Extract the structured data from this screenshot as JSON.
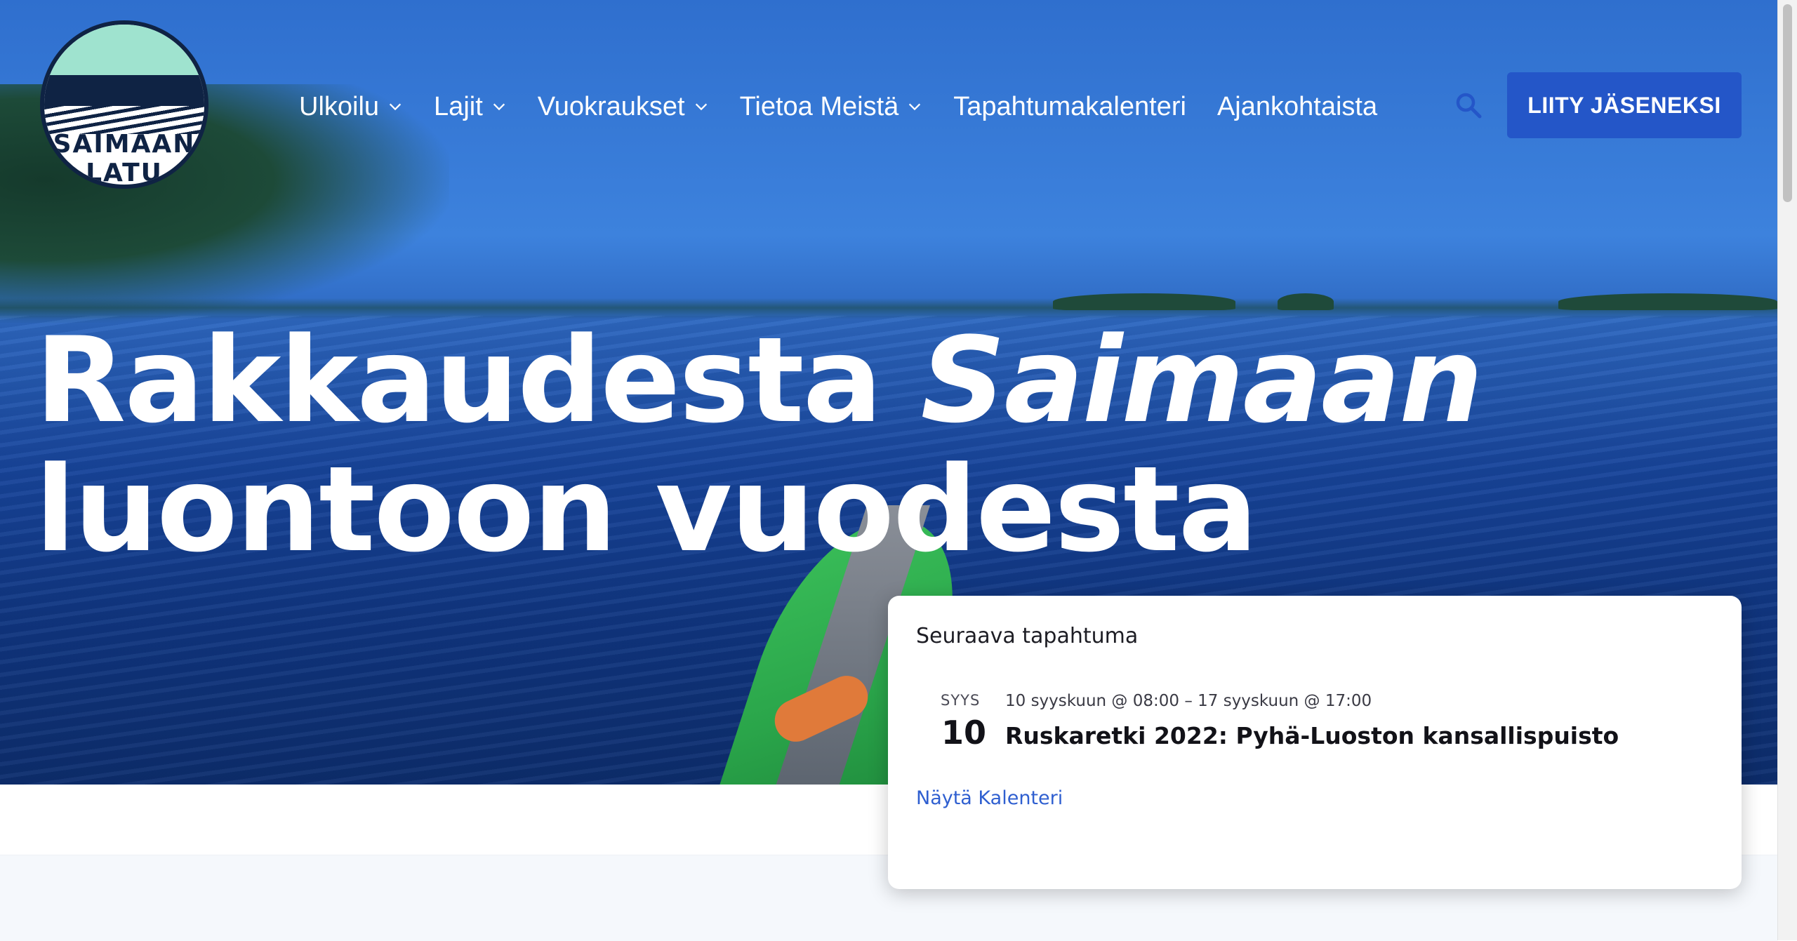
{
  "logo": {
    "text": "SAIMAAN LATU"
  },
  "nav": {
    "items": [
      {
        "label": "Ulkoilu",
        "has_dropdown": true
      },
      {
        "label": "Lajit",
        "has_dropdown": true
      },
      {
        "label": "Vuokraukset",
        "has_dropdown": true
      },
      {
        "label": "Tietoa Meistä",
        "has_dropdown": true
      },
      {
        "label": "Tapahtumakalenteri",
        "has_dropdown": false
      },
      {
        "label": "Ajankohtaista",
        "has_dropdown": false
      }
    ],
    "search_icon": "search-icon",
    "cta_label": "LIITY JÄSENEKSI"
  },
  "hero": {
    "line1": "Rakkaudesta",
    "line1_emphasis": "Saimaan",
    "line2": "luontoon vuodesta"
  },
  "event": {
    "heading": "Seuraava tapahtuma",
    "month": "SYYS",
    "day": "10",
    "datetime": "10 syyskuun @ 08:00 – 17 syyskuun @ 17:00",
    "title": "Ruskaretki 2022: Pyhä-Luoston kansallispuisto",
    "calendar_link": "Näytä Kalenteri"
  },
  "colors": {
    "accent": "#2456c8",
    "link": "#2f5fd0",
    "logo_navy": "#0f2344"
  }
}
